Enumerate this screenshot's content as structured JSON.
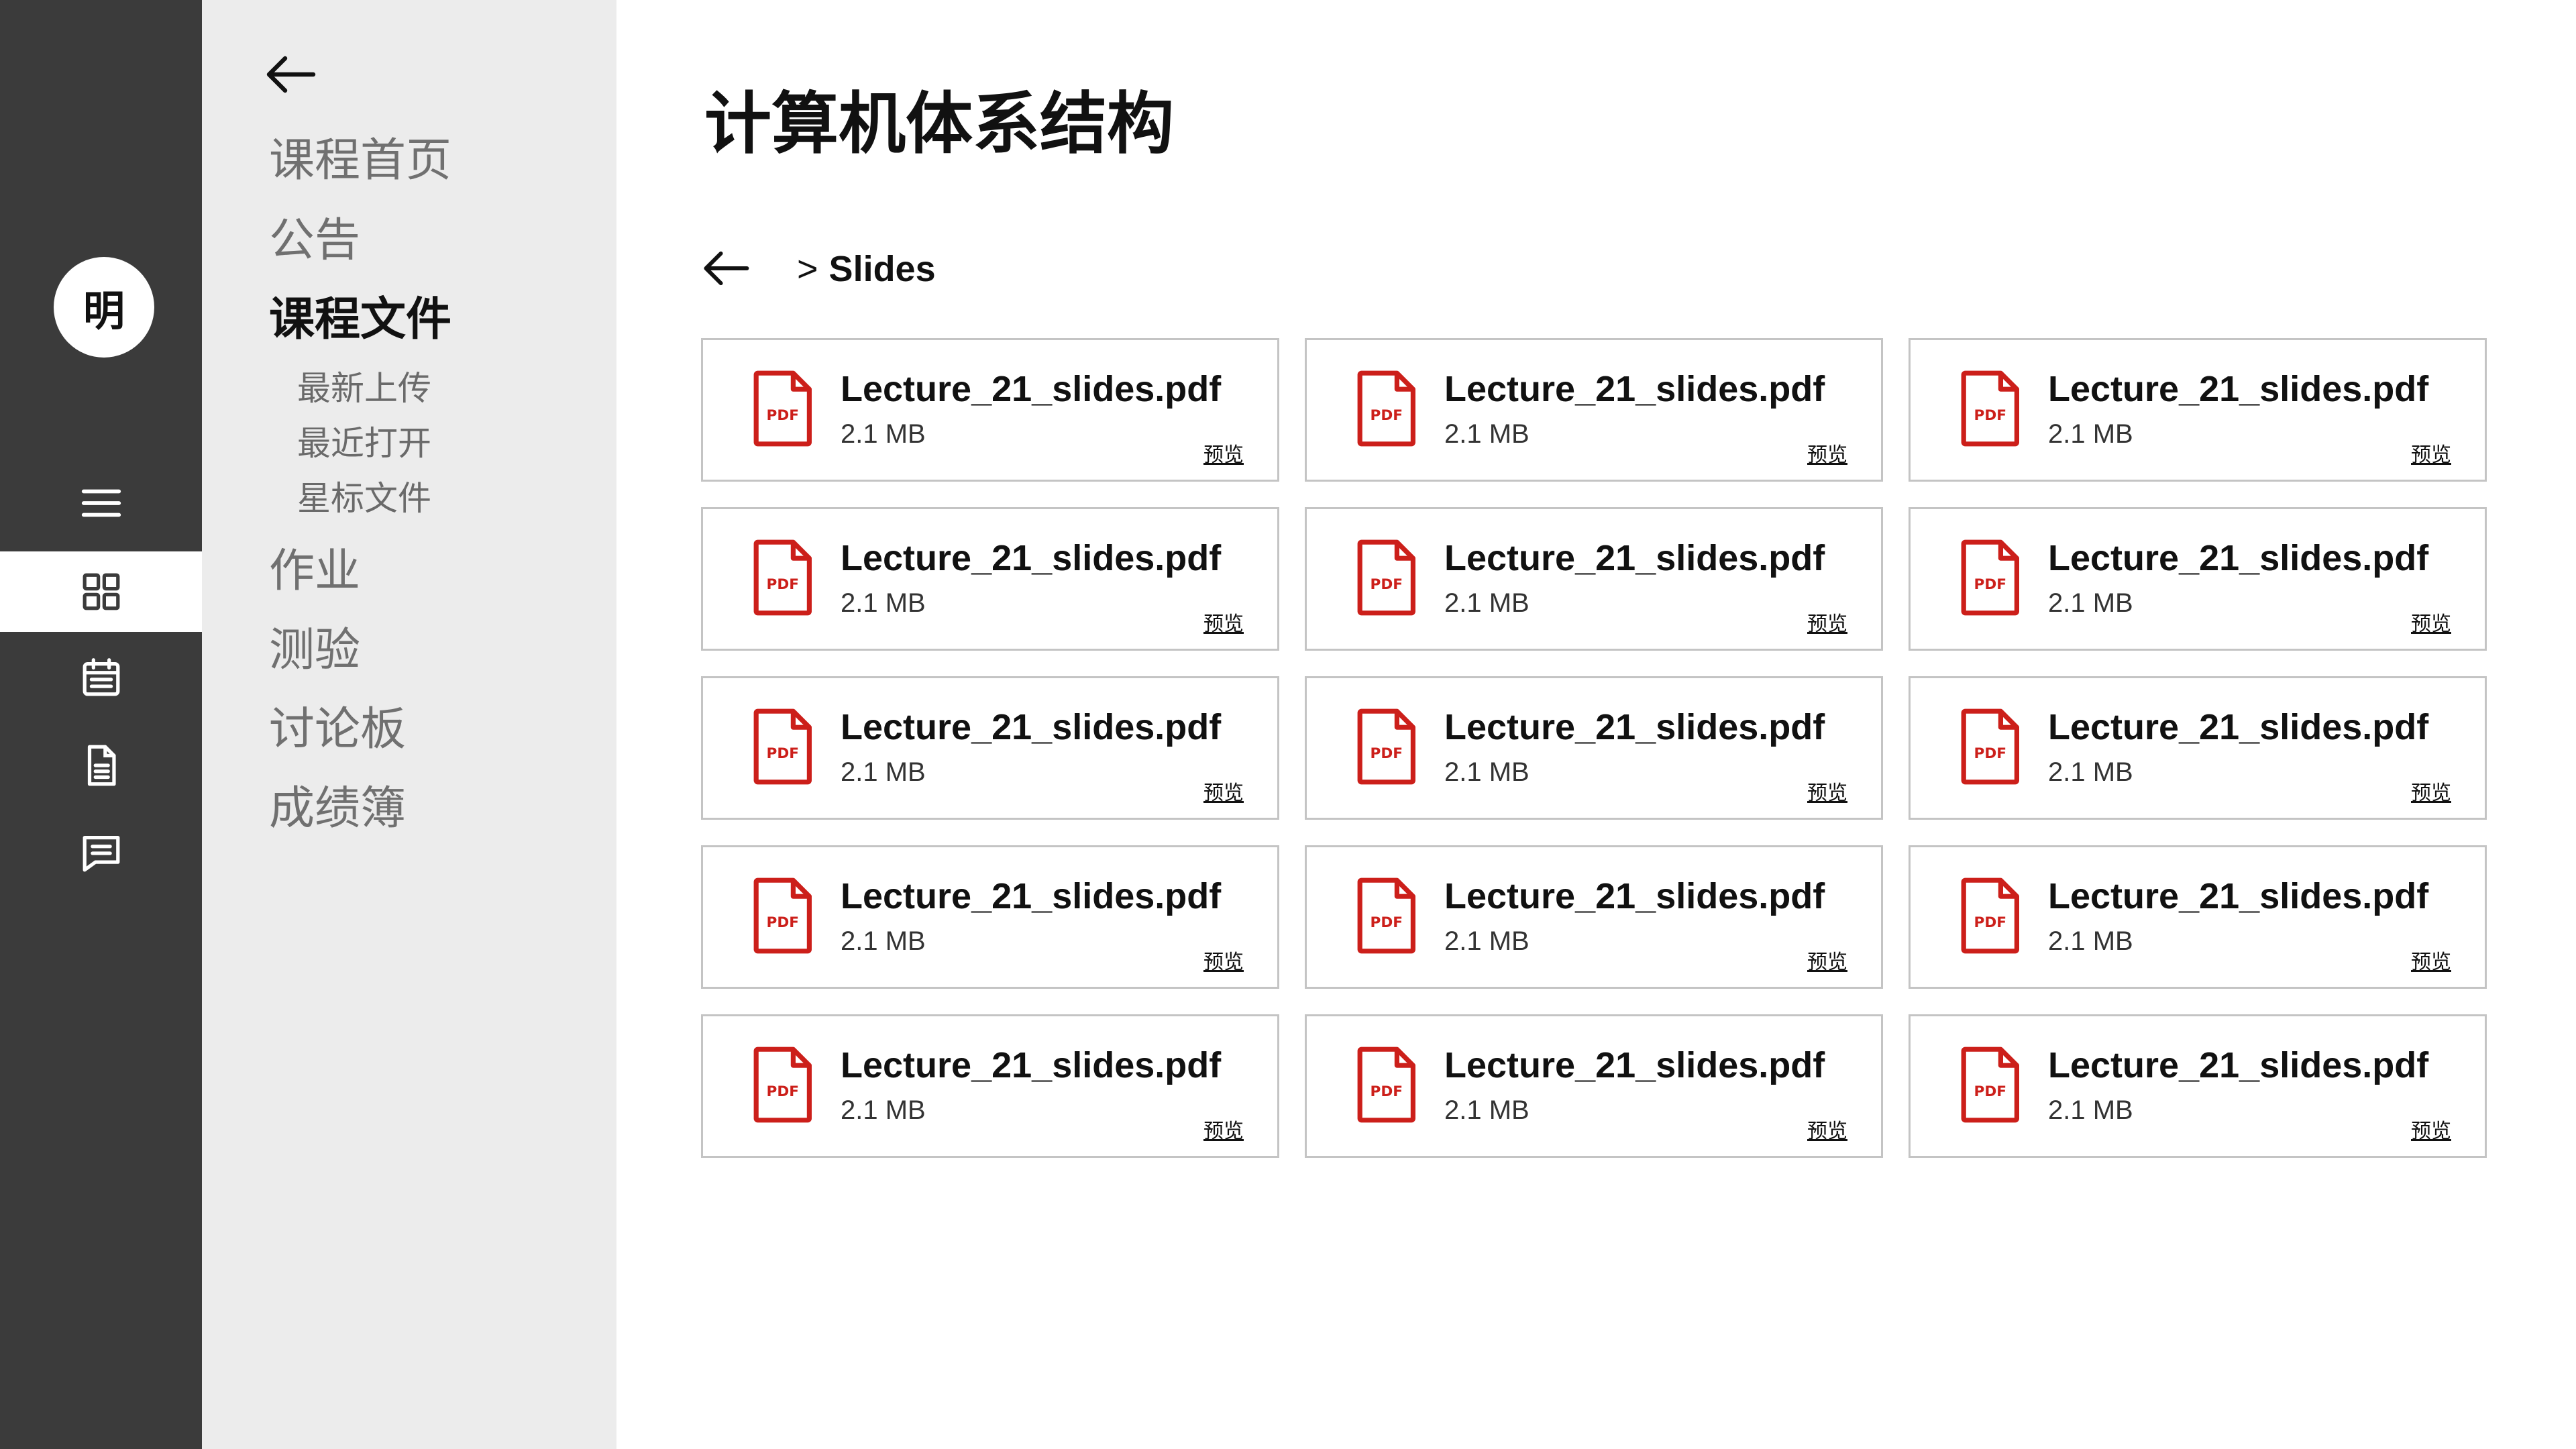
{
  "user": {
    "avatar_text": "明"
  },
  "rail": {
    "icons": [
      "menu-icon",
      "grid-icon",
      "calendar-icon",
      "document-icon",
      "chat-icon"
    ],
    "active": "grid-icon"
  },
  "course_nav": {
    "items": [
      {
        "label": "课程首页"
      },
      {
        "label": "公告"
      },
      {
        "label": "课程文件"
      },
      {
        "label": "作业"
      },
      {
        "label": "测验"
      },
      {
        "label": "讨论板"
      },
      {
        "label": "成绩簿"
      }
    ],
    "active_index": 2,
    "sub_items": [
      {
        "label": "最新上传"
      },
      {
        "label": "最近打开"
      },
      {
        "label": "星标文件"
      }
    ]
  },
  "main": {
    "title": "计算机体系结构",
    "breadcrumb": {
      "separator": ">",
      "current": "Slides"
    },
    "icon_badge": "PDF",
    "files": [
      {
        "name": "Lecture_21_slides.pdf",
        "size": "2.1 MB",
        "action": "预览"
      },
      {
        "name": "Lecture_21_slides.pdf",
        "size": "2.1 MB",
        "action": "预览"
      },
      {
        "name": "Lecture_21_slides.pdf",
        "size": "2.1 MB",
        "action": "预览"
      },
      {
        "name": "Lecture_21_slides.pdf",
        "size": "2.1 MB",
        "action": "预览"
      },
      {
        "name": "Lecture_21_slides.pdf",
        "size": "2.1 MB",
        "action": "预览"
      },
      {
        "name": "Lecture_21_slides.pdf",
        "size": "2.1 MB",
        "action": "预览"
      },
      {
        "name": "Lecture_21_slides.pdf",
        "size": "2.1 MB",
        "action": "预览"
      },
      {
        "name": "Lecture_21_slides.pdf",
        "size": "2.1 MB",
        "action": "预览"
      },
      {
        "name": "Lecture_21_slides.pdf",
        "size": "2.1 MB",
        "action": "预览"
      },
      {
        "name": "Lecture_21_slides.pdf",
        "size": "2.1 MB",
        "action": "预览"
      },
      {
        "name": "Lecture_21_slides.pdf",
        "size": "2.1 MB",
        "action": "预览"
      },
      {
        "name": "Lecture_21_slides.pdf",
        "size": "2.1 MB",
        "action": "预览"
      },
      {
        "name": "Lecture_21_slides.pdf",
        "size": "2.1 MB",
        "action": "预览"
      },
      {
        "name": "Lecture_21_slides.pdf",
        "size": "2.1 MB",
        "action": "预览"
      },
      {
        "name": "Lecture_21_slides.pdf",
        "size": "2.1 MB",
        "action": "预览"
      }
    ]
  },
  "colors": {
    "rail_bg": "#3b3b3b",
    "nav_bg": "#ececec",
    "pdf_red": "#cc1f1a",
    "card_border": "#c4c4c4"
  }
}
